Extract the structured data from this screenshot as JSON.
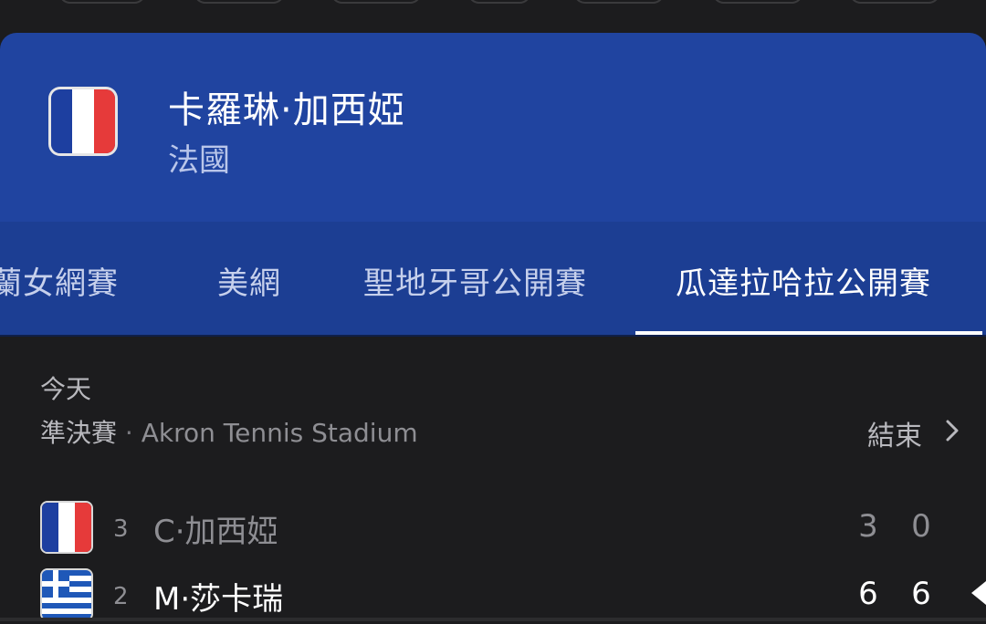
{
  "header": {
    "player_name": "卡羅琳·加西婭",
    "country": "法國",
    "flag": "france-flag"
  },
  "tabs": [
    {
      "label": "蘭女網賽",
      "active": false
    },
    {
      "label": "美網",
      "active": false
    },
    {
      "label": "聖地牙哥公開賽",
      "active": false
    },
    {
      "label": "瓜達拉哈拉公開賽",
      "active": true
    }
  ],
  "match": {
    "date": "今天",
    "round": "準決賽",
    "separator": "·",
    "venue": "Akron Tennis Stadium",
    "status": "結束",
    "players": [
      {
        "seed": "3",
        "name": "C·加西婭",
        "flag": "france-flag",
        "scores": [
          "3",
          "0"
        ],
        "winner": false
      },
      {
        "seed": "2",
        "name": "M·莎卡瑞",
        "flag": "greece-flag",
        "scores": [
          "6",
          "6"
        ],
        "winner": true
      }
    ]
  },
  "colors": {
    "header_bg": "#2044a0",
    "tabs_bg": "#1c3e93",
    "content_bg": "#1c1c1e",
    "winner_text": "#ffffff",
    "loser_text": "#8e8e93"
  }
}
